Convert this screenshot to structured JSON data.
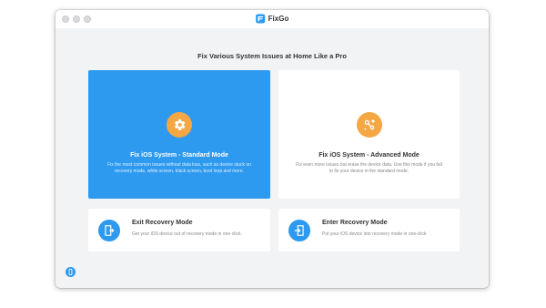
{
  "app": {
    "name": "FixGo",
    "headline": "Fix Various System Issues at Home Like a Pro"
  },
  "cards": {
    "standard": {
      "title": "Fix iOS System - Standard Mode",
      "description": "Fix the most common issues without data loss, such as device stuck on recovery mode, white screen, black screen, boot loop and more.",
      "icon": "gear-icon"
    },
    "advanced": {
      "title": "Fix iOS System - Advanced Mode",
      "description": "Fix even more issues but erase the device data. Use this mode if you fail to fix your device in the standard mode.",
      "icon": "tools-icon"
    },
    "exit": {
      "title": "Exit Recovery Mode",
      "description": "Get your iOS device out of recovery mode in one-click.",
      "icon": "exit-door-icon"
    },
    "enter": {
      "title": "Enter Recovery Mode",
      "description": "Put your iOS device into recovery mode in one-click",
      "icon": "enter-door-icon"
    }
  },
  "colors": {
    "accent": "#2d9af0",
    "orange": "#f4a743"
  },
  "footer": {
    "icon": "device-info-icon"
  }
}
